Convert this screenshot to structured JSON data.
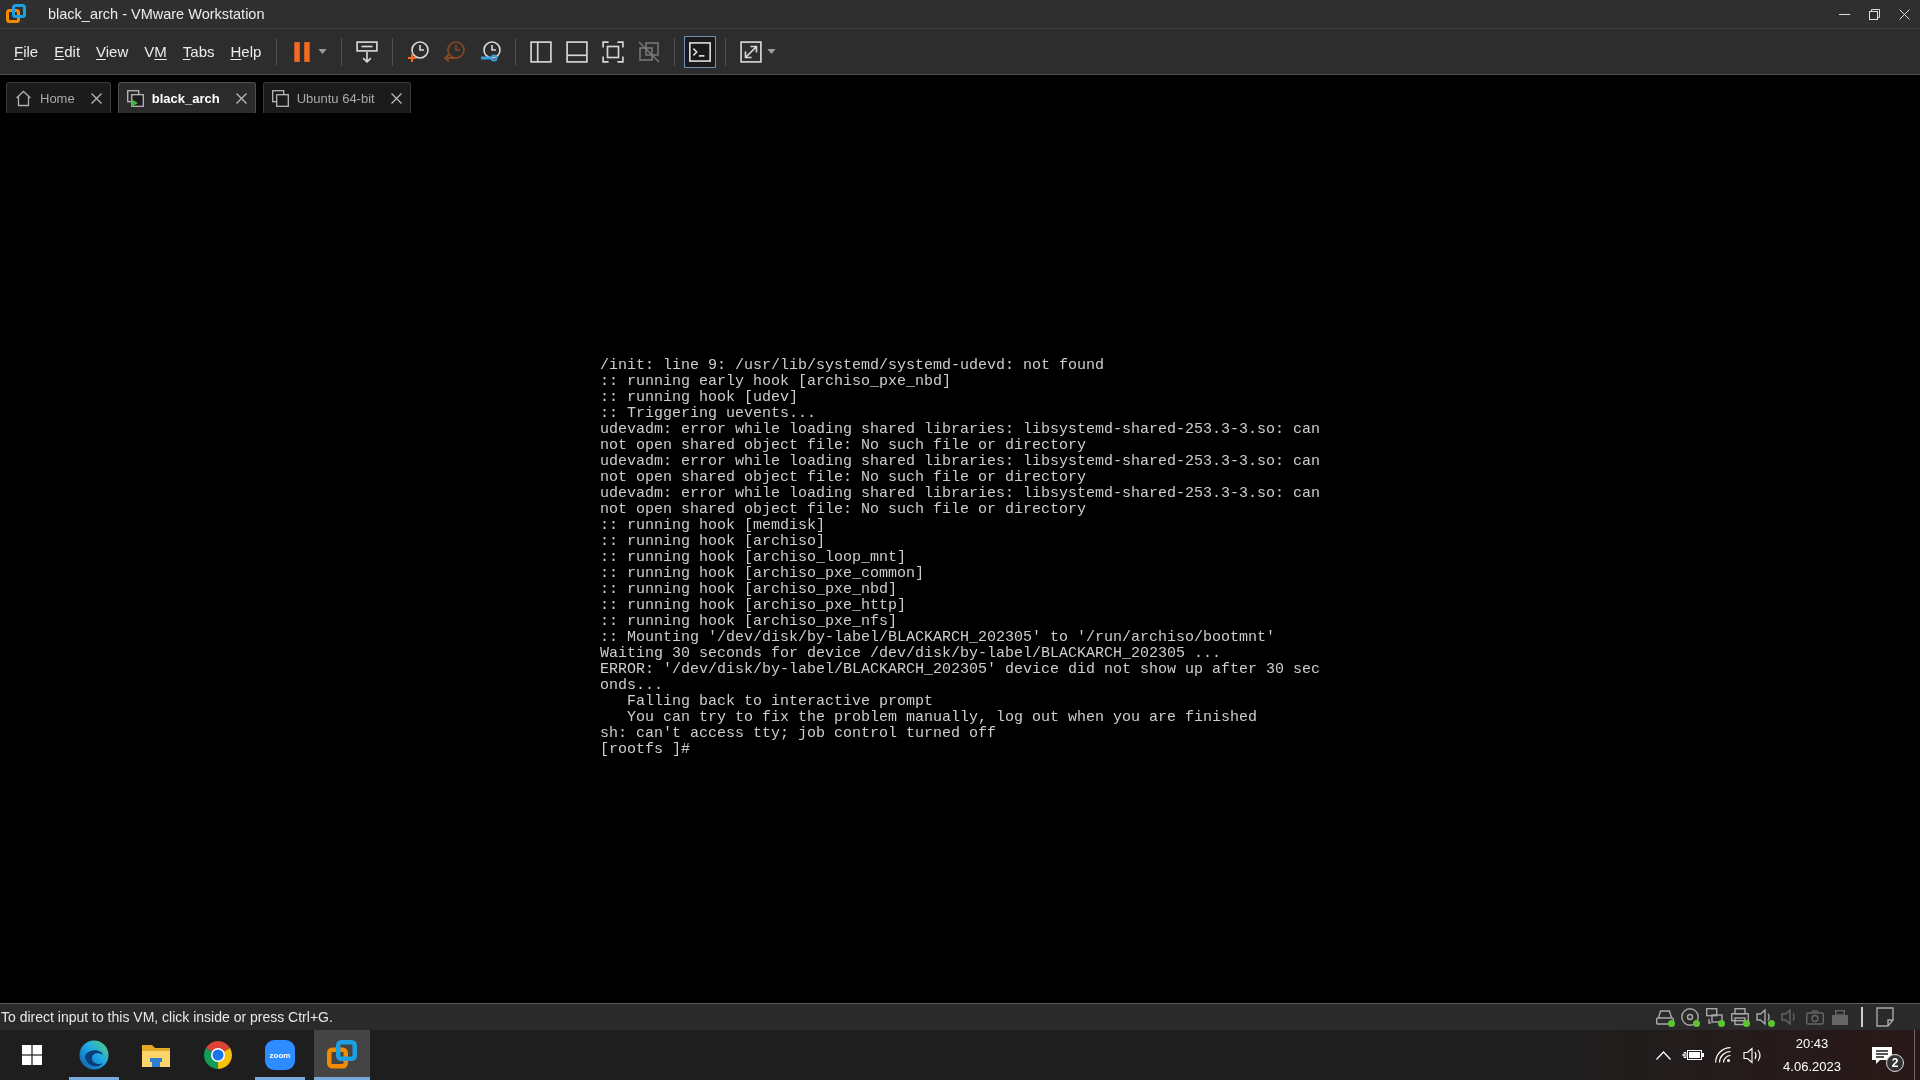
{
  "window": {
    "title": "black_arch - VMware Workstation"
  },
  "menu": [
    {
      "key": "F",
      "after": "ile"
    },
    {
      "key": "E",
      "after": "dit"
    },
    {
      "key": "V",
      "after": "iew"
    },
    {
      "before": "V",
      "key": "M"
    },
    {
      "key": "T",
      "after": "abs"
    },
    {
      "key": "H",
      "after": "elp"
    }
  ],
  "toolbar": {
    "groups": [
      {
        "buttons": [
          {
            "kind": "pause",
            "selected": false,
            "disabled": false,
            "dropdown": true
          }
        ]
      },
      {
        "buttons": [
          {
            "kind": "send-keys",
            "selected": false,
            "disabled": false,
            "dropdown": false
          }
        ]
      },
      {
        "buttons": [
          {
            "kind": "snapshot-take",
            "selected": false,
            "disabled": false,
            "dropdown": false
          },
          {
            "kind": "snapshot-revert",
            "selected": false,
            "disabled": true,
            "dropdown": false
          },
          {
            "kind": "snapshot-manager",
            "selected": false,
            "disabled": false,
            "dropdown": false
          }
        ]
      },
      {
        "buttons": [
          {
            "kind": "library",
            "selected": false,
            "disabled": false,
            "dropdown": false
          },
          {
            "kind": "thumbnails",
            "selected": false,
            "disabled": false,
            "dropdown": false
          },
          {
            "kind": "fullscreen",
            "selected": false,
            "disabled": false,
            "dropdown": false
          },
          {
            "kind": "unity",
            "selected": false,
            "disabled": true,
            "dropdown": false
          }
        ]
      },
      {
        "buttons": [
          {
            "kind": "console",
            "selected": true,
            "disabled": false,
            "dropdown": false
          }
        ]
      },
      {
        "buttons": [
          {
            "kind": "stretch",
            "selected": false,
            "disabled": false,
            "dropdown": true
          }
        ]
      }
    ]
  },
  "tabs": [
    {
      "kind": "home",
      "label": "Home",
      "selected": false,
      "running": false
    },
    {
      "kind": "vm",
      "label": "black_arch",
      "selected": true,
      "running": true
    },
    {
      "kind": "vm",
      "label": "Ubuntu 64-bit",
      "selected": false,
      "running": false
    }
  ],
  "console": {
    "lines": [
      "/init: line 9: /usr/lib/systemd/systemd-udevd: not found",
      ":: running early hook [archiso_pxe_nbd]",
      ":: running hook [udev]",
      ":: Triggering uevents...",
      "udevadm: error while loading shared libraries: libsystemd-shared-253.3-3.so: can",
      "not open shared object file: No such file or directory",
      "udevadm: error while loading shared libraries: libsystemd-shared-253.3-3.so: can",
      "not open shared object file: No such file or directory",
      "udevadm: error while loading shared libraries: libsystemd-shared-253.3-3.so: can",
      "not open shared object file: No such file or directory",
      ":: running hook [memdisk]",
      ":: running hook [archiso]",
      ":: running hook [archiso_loop_mnt]",
      ":: running hook [archiso_pxe_common]",
      ":: running hook [archiso_pxe_nbd]",
      ":: running hook [archiso_pxe_http]",
      ":: running hook [archiso_pxe_nfs]",
      ":: Mounting '/dev/disk/by-label/BLACKARCH_202305' to '/run/archiso/bootmnt'",
      "Waiting 30 seconds for device /dev/disk/by-label/BLACKARCH_202305 ...",
      "ERROR: '/dev/disk/by-label/BLACKARCH_202305' device did not show up after 30 sec",
      "onds...",
      "   Falling back to interactive prompt",
      "   You can try to fix the problem manually, log out when you are finished",
      "sh: can't access tty; job control turned off",
      "[rootfs ]#"
    ]
  },
  "status_bar": {
    "message": "To direct input to this VM, click inside or press Ctrl+G.",
    "devices": [
      {
        "kind": "hard-disk",
        "active": true
      },
      {
        "kind": "cd",
        "active": true
      },
      {
        "kind": "network",
        "active": true
      },
      {
        "kind": "printer",
        "active": true
      },
      {
        "kind": "sound",
        "active": true
      },
      {
        "kind": "sound",
        "active": false
      },
      {
        "kind": "camera",
        "active": false
      },
      {
        "kind": "usb",
        "active": false
      }
    ]
  },
  "taskbar": {
    "apps": [
      {
        "kind": "edge",
        "selected": false,
        "running": true
      },
      {
        "kind": "explorer",
        "selected": false,
        "running": false
      },
      {
        "kind": "chrome",
        "selected": false,
        "running": false
      },
      {
        "kind": "zoom",
        "label": "zoom",
        "selected": false,
        "running": true
      },
      {
        "kind": "vmware",
        "selected": true,
        "running": true
      }
    ],
    "time": "20:43",
    "date": "4.06.2023",
    "notifications": "2"
  }
}
